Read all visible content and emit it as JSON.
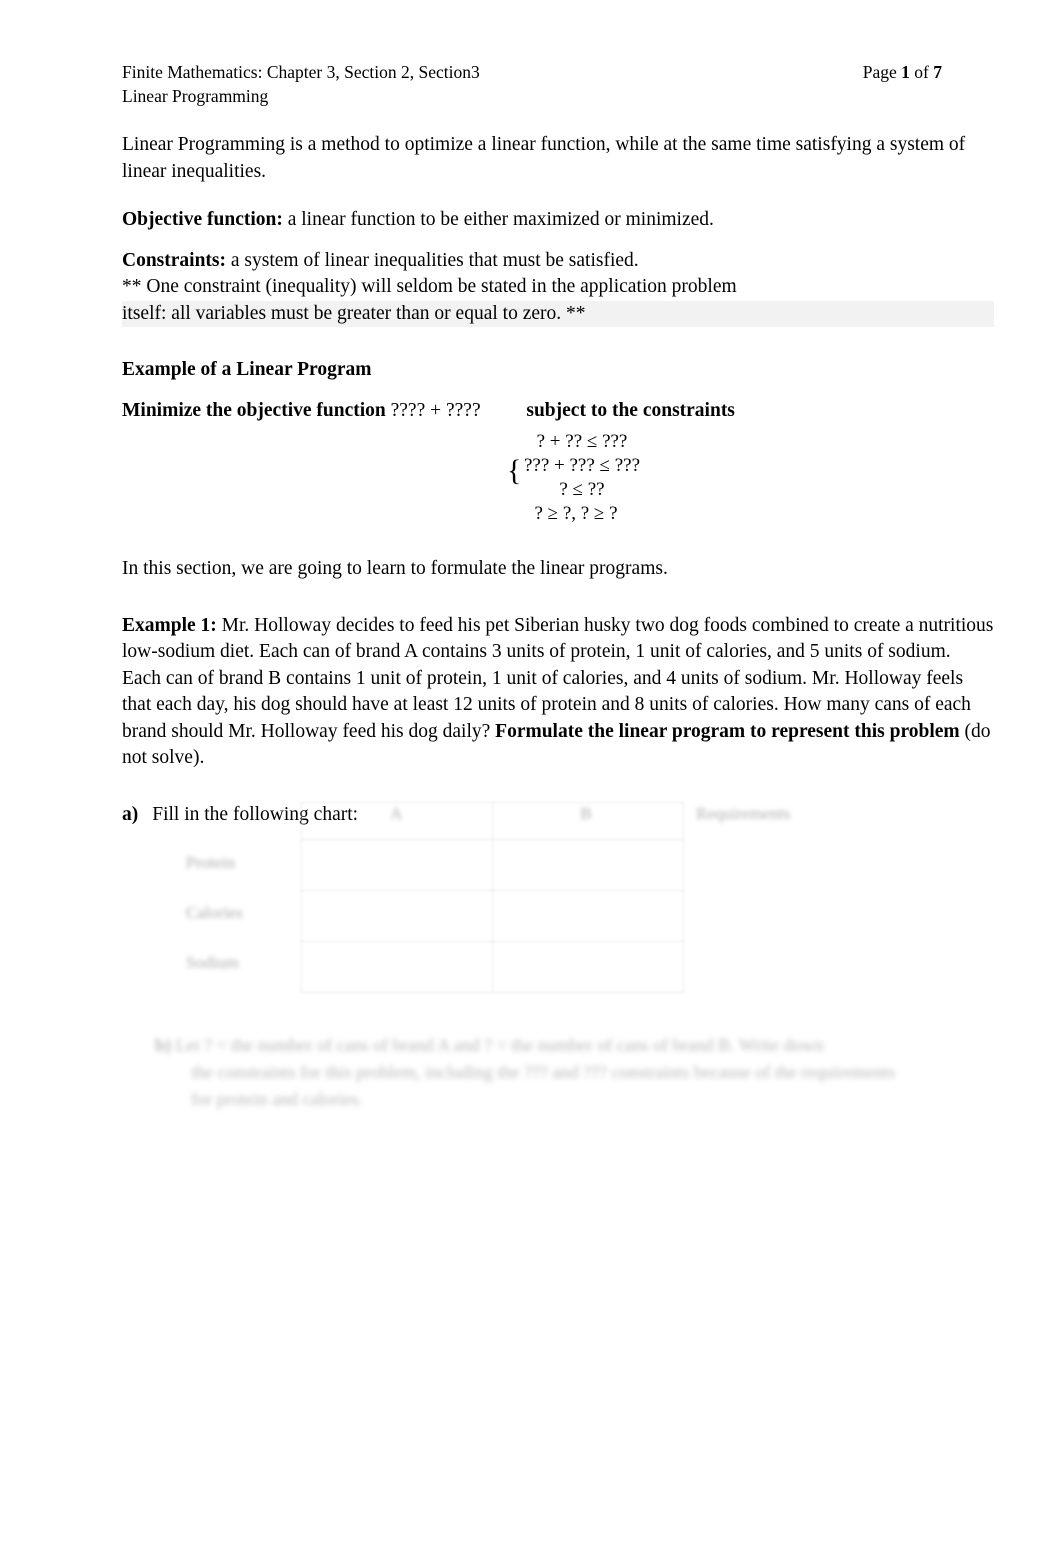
{
  "document": {
    "header": {
      "title_line1": "Finite Mathematics: Chapter 3, Section 2, Section3",
      "title_line2": "Linear Programming",
      "page_label": "Page",
      "page_number": "1",
      "page_of": "of",
      "page_total": "7"
    },
    "intro": {
      "paragraph": "Linear Programming is a method to optimize a linear function, while at the same time satisfying a system of linear inequalities."
    },
    "definitions": {
      "objective_term": "Objective function:",
      "objective_text": " a linear function to be either maximized or minimized.",
      "constraints_term": "Constraints:",
      "constraints_text": " a system of linear inequalities that must be satisfied.",
      "constraints_note_line1": "** One constraint (inequality) will seldom be stated in the application problem",
      "constraints_note_line2": "itself:  all variables must be greater than or equal to zero. **"
    },
    "example_block": {
      "heading": "Example of a Linear Program",
      "minimize_label": "Minimize the objective function",
      "objective_expression": "???? + ????",
      "subject_label": "subject to the constraints",
      "brace": "{",
      "constraint_lines": [
        "? + ?? ≤ ???",
        "??? + ??? ≤ ???",
        "? ≤ ??",
        "? ≥ ?, ? ≥ ?"
      ]
    },
    "section_intro": "In this section, we are going to learn to formulate the linear programs.",
    "example1": {
      "label": "Example 1:",
      "body": "  Mr. Holloway decides to feed his pet Siberian husky two dog foods combined to create a nutritious low-sodium diet. Each can of brand A contains 3 units of protein, 1 unit of calories, and 5 units of sodium. Each can of brand B contains 1 unit of protein, 1 unit of calories, and 4 units of sodium. Mr. Holloway feels that each day, his dog should have at least 12 units of protein and 8 units of calories. How many cans of each brand should Mr. Holloway feed his dog daily? ",
      "bold_tail": "Formulate the linear program to represent this problem",
      "tail": " (do not solve)."
    },
    "item_a": {
      "marker": "a)",
      "text": "Fill in the following chart:"
    },
    "chart": {
      "column_headers": [
        "",
        "A",
        "B",
        "Requirements"
      ],
      "rows": [
        {
          "label": "Protein",
          "a": "",
          "b": "",
          "requirements": ""
        },
        {
          "label": "Calories",
          "a": "",
          "b": "",
          "requirements": ""
        },
        {
          "label": "Sodium",
          "a": "",
          "b": "",
          "requirements": ""
        }
      ]
    },
    "item_b": {
      "marker": "b)",
      "line1": "Let ? = the number of cans of brand A and ? = the number of cans of brand B. Write down",
      "line2": "the constraints for this problem, including the ??? and ??? constraints because of the requirements",
      "line3": "for protein and calories."
    }
  }
}
